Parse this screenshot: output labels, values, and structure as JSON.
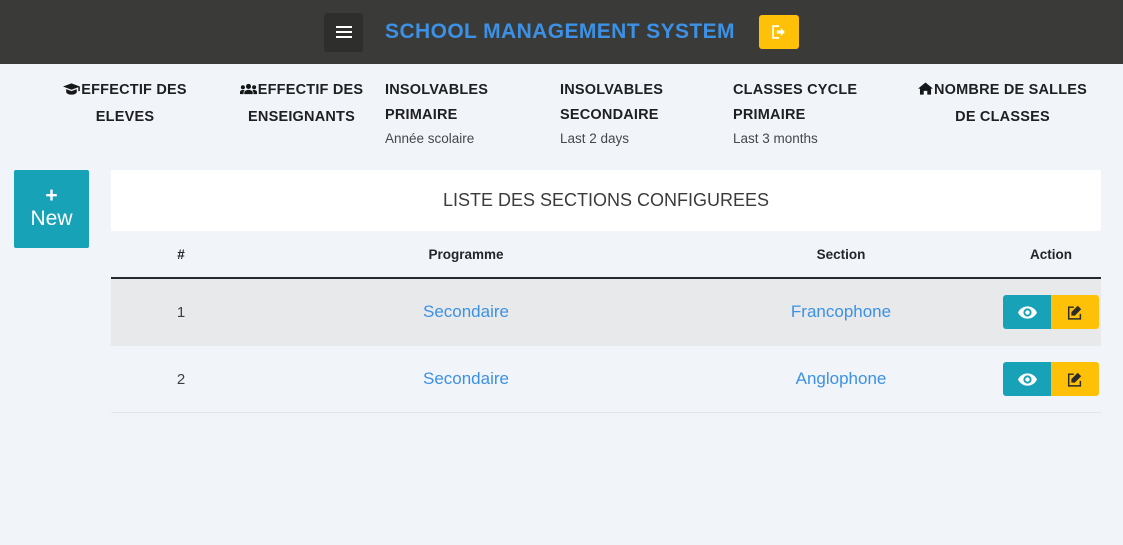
{
  "header": {
    "menu_toggle_name": "hamburger-icon",
    "brand": "SCHOOL MANAGEMENT SYSTEM",
    "logout_icon": "sign-out-icon",
    "brand_color": "#3c91e6",
    "bar_color": "#3a3a38",
    "accent_yellow": "#ffc107"
  },
  "navstrip": {
    "items": [
      {
        "icon": "graduation-cap-icon",
        "label": "EFFECTIF DES ELEVES",
        "sub": ""
      },
      {
        "icon": "users-icon",
        "label": "EFFECTIF DES ENSEIGNANTS",
        "sub": ""
      },
      {
        "icon": "",
        "label": "INSOLVABLES PRIMAIRE",
        "sub": "Année scolaire"
      },
      {
        "icon": "",
        "label": "INSOLVABLES SECONDAIRE",
        "sub": "Last 2 days"
      },
      {
        "icon": "",
        "label": "CLASSES CYCLE PRIMAIRE",
        "sub": "Last 3 months"
      },
      {
        "icon": "home-icon",
        "label": "NOMBRE DE SALLES DE CLASSES",
        "sub": ""
      }
    ]
  },
  "new_button": {
    "plus": "+",
    "label": "New",
    "color": "#17a2b8"
  },
  "panel": {
    "title": "LISTE DES SECTIONS CONFIGUREES",
    "columns": [
      "#",
      "Programme",
      "Section",
      "Action"
    ],
    "rows": [
      {
        "idx": "1",
        "programme": "Secondaire",
        "section": "Francophone",
        "view_icon": "eye-icon",
        "edit_icon": "pencil-square-icon"
      },
      {
        "idx": "2",
        "programme": "Secondaire",
        "section": "Anglophone",
        "view_icon": "eye-icon",
        "edit_icon": "pencil-square-icon"
      }
    ]
  }
}
